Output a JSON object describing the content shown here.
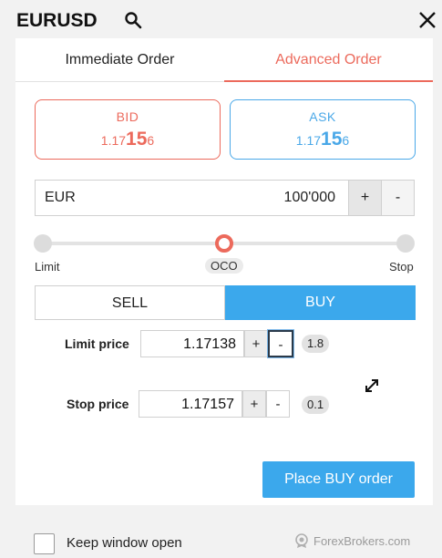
{
  "window": {
    "title": "EURUSD"
  },
  "tabs": [
    {
      "label": "Immediate Order",
      "active": false
    },
    {
      "label": "Advanced Order",
      "active": true
    }
  ],
  "quotes": {
    "bid": {
      "label": "BID",
      "prefix": "1.17",
      "big": "15",
      "suffix": "6"
    },
    "ask": {
      "label": "ASK",
      "prefix": "1.17",
      "big": "15",
      "suffix": "6"
    }
  },
  "amount": {
    "currency": "EUR",
    "value": "100'000",
    "plus": "+",
    "minus": "-"
  },
  "order_type": {
    "labels": [
      "Limit",
      "OCO",
      "Stop"
    ],
    "selected": "OCO"
  },
  "side": {
    "sell": "SELL",
    "buy": "BUY",
    "selected": "BUY"
  },
  "limit_price": {
    "label": "Limit price",
    "value": "1.17138",
    "plus": "+",
    "minus": "-",
    "distance": "1.8"
  },
  "stop_price": {
    "label": "Stop price",
    "value": "1.17157",
    "plus": "+",
    "minus": "-",
    "distance": "0.1"
  },
  "place_button": "Place BUY order",
  "footer": {
    "keep_open_label": "Keep window open",
    "keep_open_checked": false,
    "watermark": "ForexBrokers.com"
  },
  "colors": {
    "accent_red": "#ec6a5c",
    "accent_blue": "#3ba8ec"
  }
}
